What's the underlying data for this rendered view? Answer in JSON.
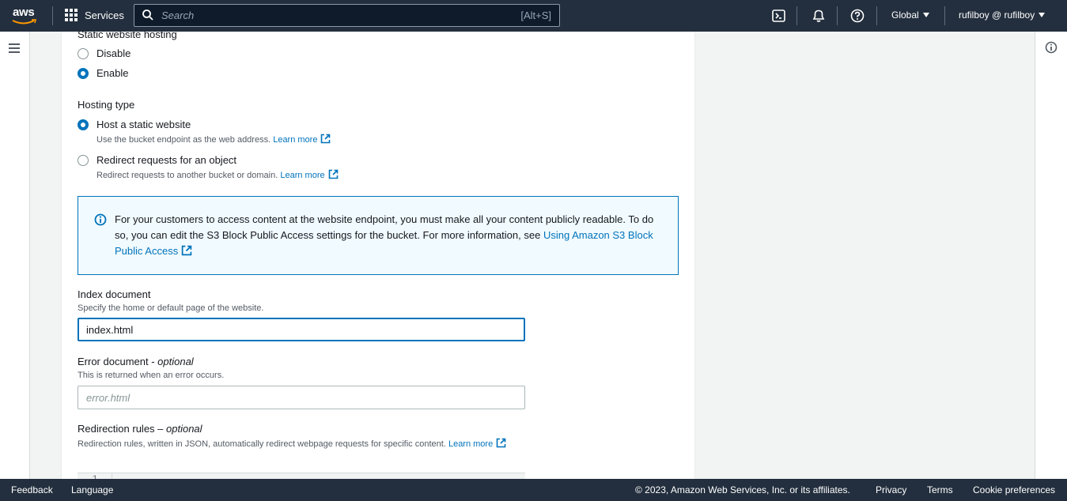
{
  "nav": {
    "logo_text": "aws",
    "services_label": "Services",
    "search_placeholder": "Search",
    "search_shortcut": "[Alt+S]",
    "region_label": "Global",
    "user_label": "rufilboy @ rufilboy",
    "icons": [
      "cloudshell-icon",
      "notifications-icon",
      "help-icon"
    ]
  },
  "form": {
    "static_hosting": {
      "label": "Static website hosting",
      "options": [
        {
          "label": "Disable",
          "selected": false
        },
        {
          "label": "Enable",
          "selected": true
        }
      ]
    },
    "hosting_type": {
      "label": "Hosting type",
      "options": [
        {
          "label": "Host a static website",
          "desc": "Use the bucket endpoint as the web address.",
          "link": "Learn more",
          "selected": true
        },
        {
          "label": "Redirect requests for an object",
          "desc": "Redirect requests to another bucket or domain.",
          "link": "Learn more",
          "selected": false
        }
      ]
    },
    "info_alert": {
      "text": "For your customers to access content at the website endpoint, you must make all your content publicly readable. To do so, you can edit the S3 Block Public Access settings for the bucket. For more information, see",
      "link": "Using Amazon S3 Block Public Access"
    },
    "index_document": {
      "label": "Index document",
      "desc": "Specify the home or default page of the website.",
      "value": "index.html"
    },
    "error_document": {
      "label": "Error document - ",
      "optional": "optional",
      "desc": "This is returned when an error occurs.",
      "placeholder": "error.html"
    },
    "redirection_rules": {
      "label": "Redirection rules – ",
      "optional": "optional",
      "desc": "Redirection rules, written in JSON, automatically redirect webpage requests for specific content.",
      "link": "Learn more",
      "line_number": "1"
    }
  },
  "footer": {
    "feedback": "Feedback",
    "language": "Language",
    "copyright": "© 2023, Amazon Web Services, Inc. or its affiliates.",
    "privacy": "Privacy",
    "terms": "Terms",
    "cookies": "Cookie preferences"
  },
  "colors": {
    "nav_bg": "#232f3e",
    "accent": "#0073bb",
    "alert_bg": "#f1faff"
  }
}
